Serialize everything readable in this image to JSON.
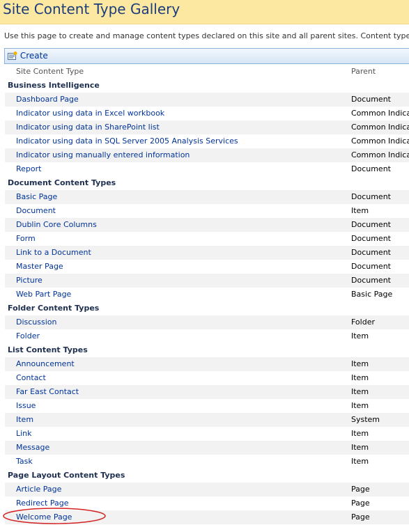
{
  "page": {
    "title": "Site Content Type Gallery",
    "description": "Use this page to create and manage content types declared on this site and all parent sites. Content types visible on this"
  },
  "toolbar": {
    "create_label": "Create",
    "create_icon": "new-item-icon"
  },
  "table": {
    "columns": {
      "type": "Site Content Type",
      "parent": "Parent"
    },
    "groups": [
      {
        "name": "Business Intelligence",
        "items": [
          {
            "type": "Dashboard Page",
            "parent": "Document"
          },
          {
            "type": "Indicator using data in Excel workbook",
            "parent": "Common Indicator Columns"
          },
          {
            "type": "Indicator using data in SharePoint list",
            "parent": "Common Indicator Columns"
          },
          {
            "type": "Indicator using data in SQL Server 2005 Analysis Services",
            "parent": "Common Indicator Columns"
          },
          {
            "type": "Indicator using manually entered information",
            "parent": "Common Indicator Columns"
          },
          {
            "type": "Report",
            "parent": "Document"
          }
        ]
      },
      {
        "name": "Document Content Types",
        "items": [
          {
            "type": "Basic Page",
            "parent": "Document"
          },
          {
            "type": "Document",
            "parent": "Item"
          },
          {
            "type": "Dublin Core Columns",
            "parent": "Document"
          },
          {
            "type": "Form",
            "parent": "Document"
          },
          {
            "type": "Link to a Document",
            "parent": "Document"
          },
          {
            "type": "Master Page",
            "parent": "Document"
          },
          {
            "type": "Picture",
            "parent": "Document"
          },
          {
            "type": "Web Part Page",
            "parent": "Basic Page"
          }
        ]
      },
      {
        "name": "Folder Content Types",
        "items": [
          {
            "type": "Discussion",
            "parent": "Folder"
          },
          {
            "type": "Folder",
            "parent": "Item"
          }
        ]
      },
      {
        "name": "List Content Types",
        "items": [
          {
            "type": "Announcement",
            "parent": "Item"
          },
          {
            "type": "Contact",
            "parent": "Item"
          },
          {
            "type": "Far East Contact",
            "parent": "Item"
          },
          {
            "type": "Issue",
            "parent": "Item"
          },
          {
            "type": "Item",
            "parent": "System"
          },
          {
            "type": "Link",
            "parent": "Item"
          },
          {
            "type": "Message",
            "parent": "Item"
          },
          {
            "type": "Task",
            "parent": "Item"
          }
        ]
      },
      {
        "name": "Page Layout Content Types",
        "items": [
          {
            "type": "Article Page",
            "parent": "Page"
          },
          {
            "type": "Redirect Page",
            "parent": "Page"
          },
          {
            "type": "Welcome Page",
            "parent": "Page"
          }
        ]
      }
    ]
  },
  "annotation": {
    "highlighted_item": "Welcome Page",
    "color": "#d42020"
  }
}
